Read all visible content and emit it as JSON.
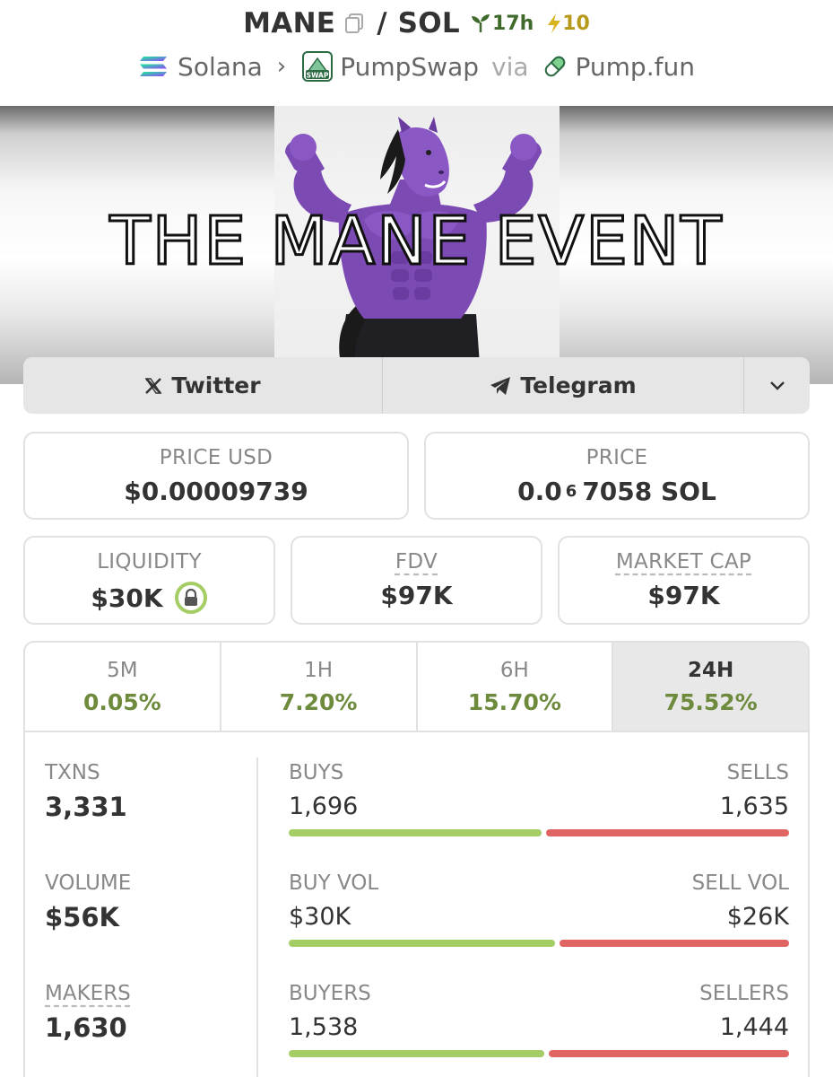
{
  "header": {
    "base_symbol": "MANE",
    "quote_symbol": "SOL",
    "age": "17h",
    "boosts": "10"
  },
  "breadcrumb": {
    "chain": "Solana",
    "dex": "PumpSwap",
    "dex_logo_text": "SWAP",
    "via_label": "via",
    "launchpad": "Pump.fun"
  },
  "banner": {
    "headline": "THE MANE EVENT"
  },
  "socials": {
    "twitter_label": "Twitter",
    "telegram_label": "Telegram"
  },
  "prices": {
    "price_usd_label": "PRICE USD",
    "price_usd": "$0.00009739",
    "price_label": "PRICE",
    "price_sol_prefix": "0.0",
    "price_sol_zeros": "6",
    "price_sol_suffix": "7058 SOL"
  },
  "metrics": {
    "liquidity_label": "LIQUIDITY",
    "liquidity": "$30K",
    "fdv_label": "FDV",
    "fdv": "$97K",
    "mcap_label": "MARKET CAP",
    "mcap": "$97K"
  },
  "timeframes": [
    {
      "label": "5M",
      "change": "0.05%"
    },
    {
      "label": "1H",
      "change": "7.20%"
    },
    {
      "label": "6H",
      "change": "15.70%"
    },
    {
      "label": "24H",
      "change": "75.52%"
    }
  ],
  "active_timeframe": "24H",
  "stats": {
    "txns_label": "TXNS",
    "txns": "3,331",
    "volume_label": "VOLUME",
    "volume": "$56K",
    "makers_label": "MAKERS",
    "makers": "1,630"
  },
  "splits": {
    "buys_label": "BUYS",
    "buys": "1,696",
    "sells_label": "SELLS",
    "sells": "1,635",
    "buys_fraction": 0.509,
    "buy_vol_label": "BUY VOL",
    "buy_vol": "$30K",
    "sell_vol_label": "SELL VOL",
    "sell_vol": "$26K",
    "buy_vol_fraction": 0.536,
    "buyers_label": "BUYERS",
    "buyers": "1,538",
    "sellers_label": "SELLERS",
    "sellers": "1,444",
    "buyers_fraction": 0.516
  },
  "colors": {
    "positive": "#6e8b3d",
    "buy_bar": "#a5cd66",
    "sell_bar": "#e06461",
    "age_green": "#3f6a2c",
    "boost_gold": "#b79a1b",
    "horse_purple": "#7b4bb3"
  }
}
